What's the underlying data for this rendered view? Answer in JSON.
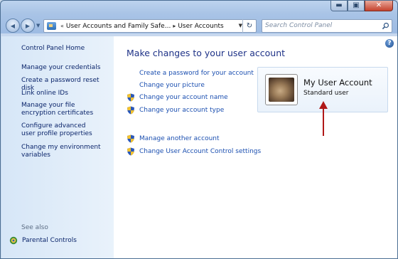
{
  "window": {
    "controls": {
      "minimize": "▬",
      "maximize": "▣",
      "close": "✕"
    }
  },
  "navigation": {
    "back": "◀",
    "forward": "▶",
    "breadcrumbs": [
      "User Accounts and Family Safe...",
      "User Accounts"
    ],
    "chevrons": "«",
    "separator": "▸",
    "search_placeholder": "Search Control Panel"
  },
  "sidebar": {
    "home": "Control Panel Home",
    "links": [
      "Manage your credentials",
      "Create a password reset disk",
      "Link online IDs",
      "Manage your file encryption certificates",
      "Configure advanced user profile properties",
      "Change my environment variables"
    ],
    "see_also": "See also",
    "parental_controls": "Parental Controls"
  },
  "main": {
    "help": "?",
    "heading": "Make changes to your user account",
    "tasks": [
      {
        "label": "Create a password for your account",
        "shield": false
      },
      {
        "label": "Change your picture",
        "shield": false
      },
      {
        "label": "Change your account name",
        "shield": true
      },
      {
        "label": "Change your account type",
        "shield": true
      }
    ],
    "tasks2": [
      {
        "label": "Manage another account",
        "shield": true
      },
      {
        "label": "Change User Account Control settings",
        "shield": true
      }
    ],
    "account": {
      "name": "My User Account",
      "type": "Standard user"
    }
  },
  "colors": {
    "link": "#1b4fb0",
    "heading": "#1e3287",
    "sidebar_link": "#0a246a",
    "arrow": "#b01818"
  }
}
